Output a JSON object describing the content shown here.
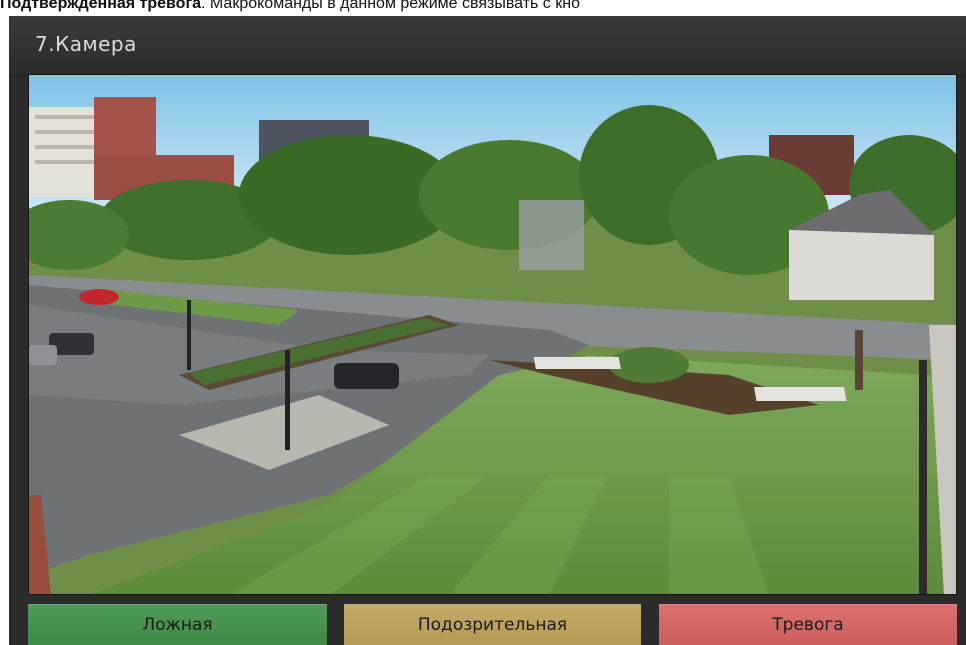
{
  "doc": {
    "bold_text": "Подтвержденная тревога",
    "rest_text": ". Макрокоманды в данном режиме связывать с кно"
  },
  "camera": {
    "title": "7.Камера"
  },
  "actions": {
    "false_label": "Ложная",
    "suspicious_label": "Подозрительная",
    "alarm_label": "Тревога"
  },
  "colors": {
    "false_button": "#4a9552",
    "suspicious_button": "#bea661",
    "alarm_button": "#d86a6a",
    "panel_background": "#2b2b2b"
  }
}
